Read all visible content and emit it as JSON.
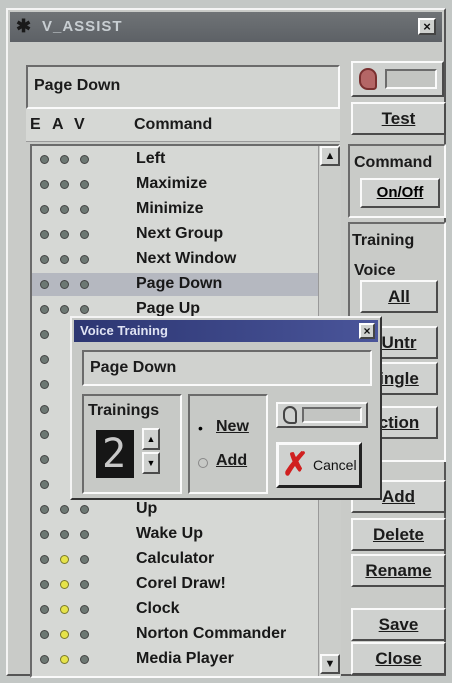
{
  "window": {
    "title": "V_ASSIST",
    "close": "×"
  },
  "selected_command": "Page Down",
  "header": {
    "e": "E",
    "a": "A",
    "v": "V",
    "command": "Command"
  },
  "buttons": {
    "test": "Test",
    "command_group": "Command",
    "on_off": "On/Off",
    "training_group": "Training",
    "voice_group": "Voice",
    "all": "All",
    "untr": "Untr",
    "single": "ingle",
    "section": "ction",
    "add": "Add",
    "delete": "Delete",
    "rename": "Rename",
    "save": "Save",
    "close": "Close"
  },
  "commands": [
    {
      "name": "Left",
      "dots": [
        "g",
        "g",
        "g"
      ]
    },
    {
      "name": "Maximize",
      "dots": [
        "g",
        "g",
        "g"
      ]
    },
    {
      "name": "Minimize",
      "dots": [
        "g",
        "g",
        "g"
      ]
    },
    {
      "name": "Next Group",
      "dots": [
        "g",
        "g",
        "g"
      ]
    },
    {
      "name": "Next Window",
      "dots": [
        "g",
        "g",
        "g"
      ]
    },
    {
      "name": "Page Down",
      "dots": [
        "g",
        "g",
        "g"
      ],
      "selected": true
    },
    {
      "name": "Page Up",
      "dots": [
        "g",
        "g",
        "g"
      ]
    },
    {
      "name": "",
      "dots": [
        "g"
      ]
    },
    {
      "name": "",
      "dots": [
        "g"
      ]
    },
    {
      "name": "",
      "dots": [
        "g"
      ]
    },
    {
      "name": "",
      "dots": [
        "g"
      ]
    },
    {
      "name": "",
      "dots": [
        "g"
      ]
    },
    {
      "name": "",
      "dots": [
        "g"
      ]
    },
    {
      "name": "",
      "dots": [
        "g"
      ]
    },
    {
      "name": "Up",
      "dots": [
        "g",
        "g",
        "g"
      ]
    },
    {
      "name": "Wake Up",
      "dots": [
        "g",
        "g",
        "g"
      ]
    },
    {
      "name": "Calculator",
      "dots": [
        "g",
        "y",
        "g"
      ]
    },
    {
      "name": "Corel Draw!",
      "dots": [
        "g",
        "y",
        "g"
      ]
    },
    {
      "name": "Clock",
      "dots": [
        "g",
        "y",
        "g"
      ]
    },
    {
      "name": "Norton Commander",
      "dots": [
        "g",
        "y",
        "g"
      ]
    },
    {
      "name": "Media Player",
      "dots": [
        "g",
        "y",
        "g"
      ]
    }
  ],
  "dialog": {
    "title": "Voice Training",
    "close": "×",
    "command": "Page Down",
    "trainings_label": "Trainings",
    "count": "2",
    "new": "New",
    "add": "Add",
    "cancel": "Cancel"
  },
  "colors": {
    "titlebar": "#6a6e72",
    "dialog_titlebar": "#2c3672",
    "dot_green": "#6d7873",
    "dot_yellow": "#e6e34a",
    "cancel_x": "#d02020"
  }
}
